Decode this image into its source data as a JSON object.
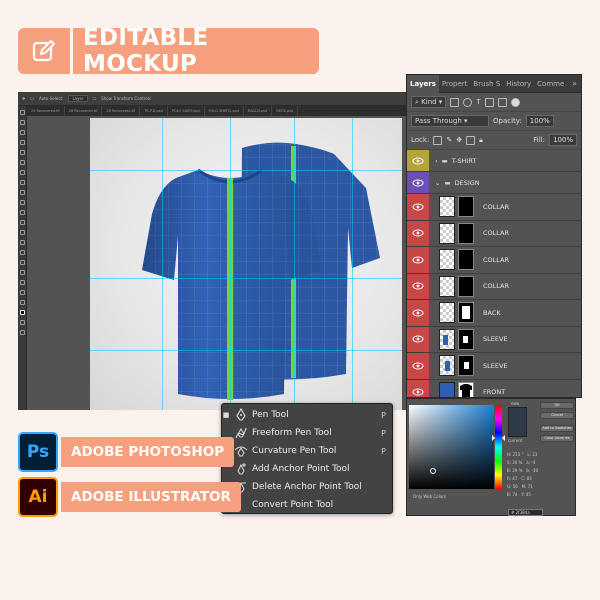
{
  "banner": {
    "title": "EDITABLE MOCKUP",
    "icon": "edit-icon"
  },
  "colors": {
    "accent": "#f6a07f",
    "ps_blue": "#31a8ff",
    "ps_bg": "#001e36",
    "ai_orange": "#ff9a00",
    "ai_bg": "#330000",
    "shirt_blue": "#2f5fb1",
    "stripe_green": "#6fd63f"
  },
  "photoshop": {
    "options_bar": [
      "Auto-Select:",
      "Layer",
      "Show Transform Controls"
    ],
    "doc_tabs": [
      "25 Recovered.tif",
      "26 Recovered.tif",
      "29 Recovered.tif",
      "TR-P-B.psd",
      "POLO SHIRT.psd",
      "POLO SHIRT2.psd",
      "RAGLN.psd",
      "NECK.psd"
    ]
  },
  "layers_panel": {
    "tabs": [
      "Layers",
      "Propert",
      "Brush S",
      "History",
      "Comme"
    ],
    "filter": "Kind",
    "blend_mode": "Pass Through",
    "opacity_label": "Opacity:",
    "opacity": "100%",
    "lock_label": "Lock:",
    "fill_label": "Fill:",
    "fill": "100%",
    "groups": [
      {
        "name": "T-SHIRT",
        "color": "#d6c23b"
      },
      {
        "name": "DESIGN",
        "color": "#7b56c7"
      }
    ],
    "layers": [
      {
        "name": "COLLAR"
      },
      {
        "name": "COLLAR"
      },
      {
        "name": "COLLAR"
      },
      {
        "name": "COLLAR"
      },
      {
        "name": "BACK"
      },
      {
        "name": "SLEEVE"
      },
      {
        "name": "SLEEVE"
      },
      {
        "name": "FRONT"
      }
    ]
  },
  "color_picker": {
    "ok": "OK",
    "cancel": "Cancel",
    "add_swatches": "Add to Swatches",
    "color_libraries": "Color Libraries",
    "new_label": "new",
    "current_label": "current",
    "only_web": "Only Web Colors",
    "fields": [
      [
        "H:",
        "213",
        "°",
        "L:",
        "23"
      ],
      [
        "S:",
        "36",
        "%",
        "a:",
        "-4"
      ],
      [
        "B:",
        "29",
        "%",
        "b:",
        "-10"
      ],
      [
        "R:",
        "47",
        "",
        "C:",
        "83"
      ],
      [
        "G:",
        "56",
        "",
        "M:",
        "71"
      ],
      [
        "B:",
        "74",
        "",
        "Y:",
        "45"
      ]
    ],
    "hex": "2f384a"
  },
  "pen_menu": {
    "items": [
      {
        "label": "Pen Tool",
        "key": "P",
        "icon": "pen-icon",
        "checked": true
      },
      {
        "label": "Freeform Pen Tool",
        "key": "P",
        "icon": "freeform-pen-icon",
        "checked": false
      },
      {
        "label": "Curvature Pen Tool",
        "key": "P",
        "icon": "curvature-pen-icon",
        "checked": false
      },
      {
        "label": "Add Anchor Point Tool",
        "key": "",
        "icon": "add-anchor-icon",
        "checked": false
      },
      {
        "label": "Delete Anchor Point Tool",
        "key": "",
        "icon": "delete-anchor-icon",
        "checked": false
      },
      {
        "label": "Convert Point Tool",
        "key": "",
        "icon": "convert-point-icon",
        "checked": false
      }
    ]
  },
  "apps": [
    {
      "logo": "Ps",
      "name": "ADOBE PHOTOSHOP"
    },
    {
      "logo": "Ai",
      "name": "ADOBE ILLUSTRATOR"
    }
  ]
}
